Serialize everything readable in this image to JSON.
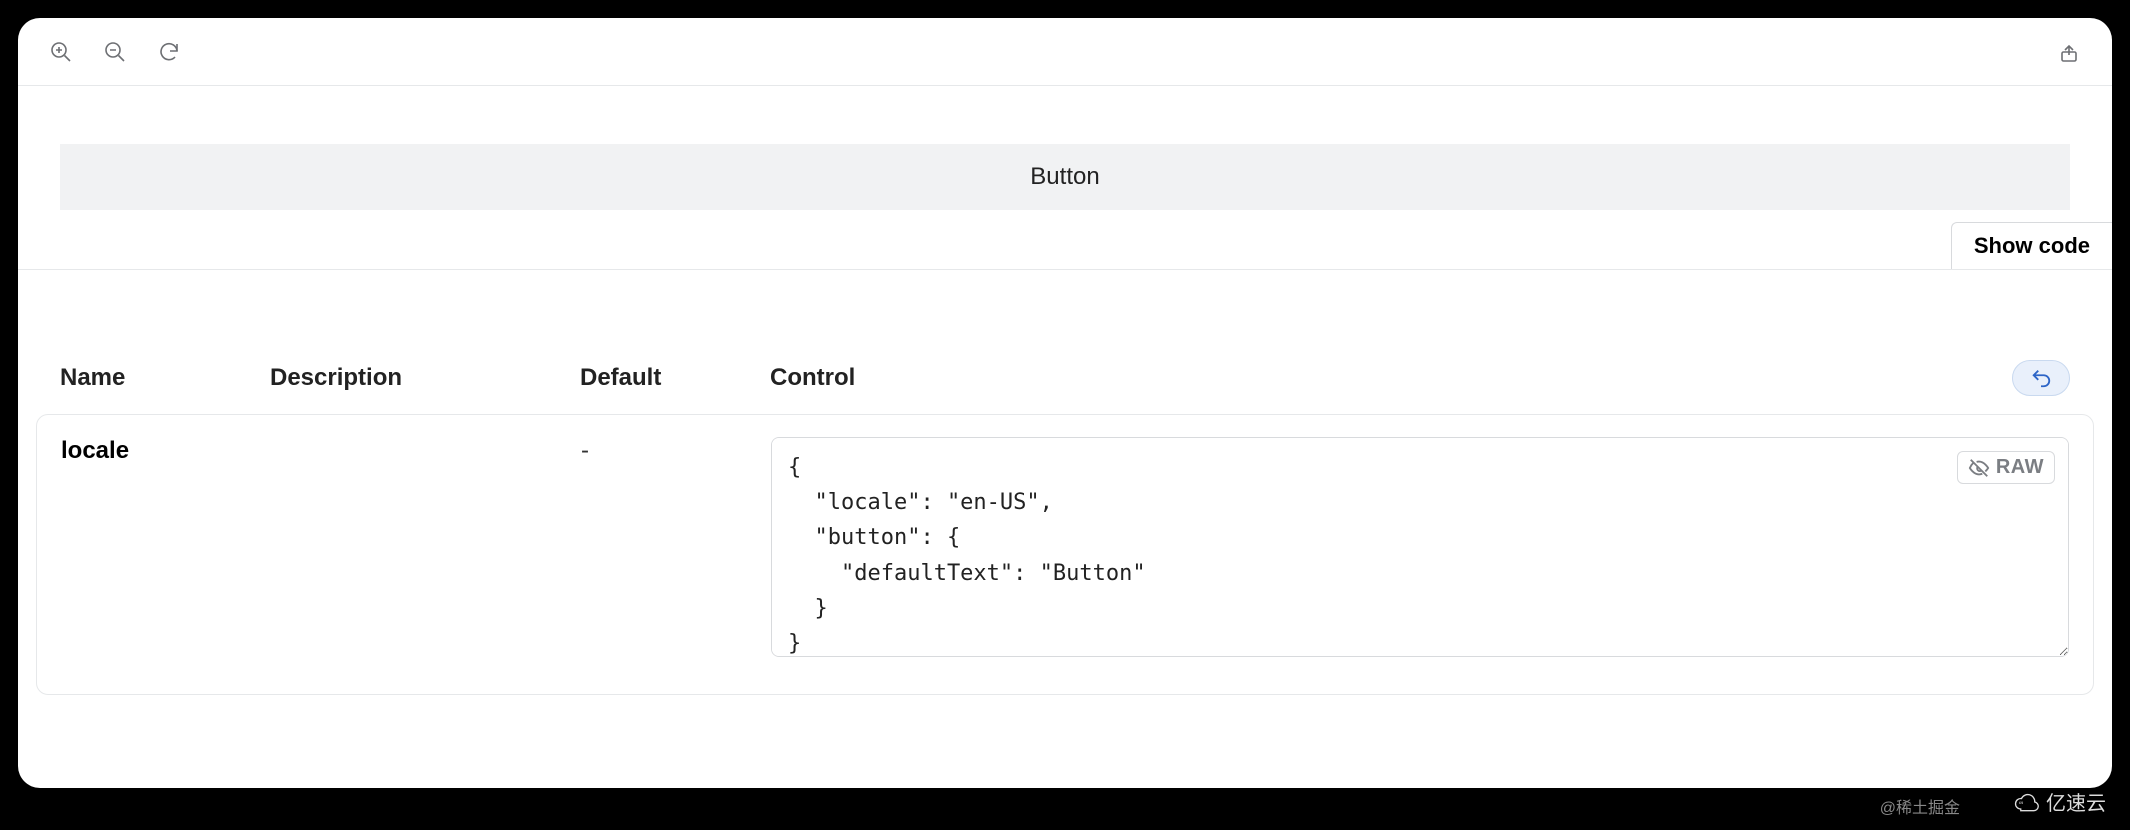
{
  "preview": {
    "button_label": "Button",
    "show_code_label": "Show code"
  },
  "args_table": {
    "headers": {
      "name": "Name",
      "description": "Description",
      "default": "Default",
      "control": "Control"
    },
    "rows": [
      {
        "name": "locale",
        "description": "",
        "default": "-",
        "control_raw_label": "RAW",
        "control_value": "{\n  \"locale\": \"en-US\",\n  \"button\": {\n    \"defaultText\": \"Button\"\n  }\n}"
      }
    ]
  },
  "watermarks": {
    "juejin": "@稀土掘金",
    "yisu": "亿速云"
  }
}
